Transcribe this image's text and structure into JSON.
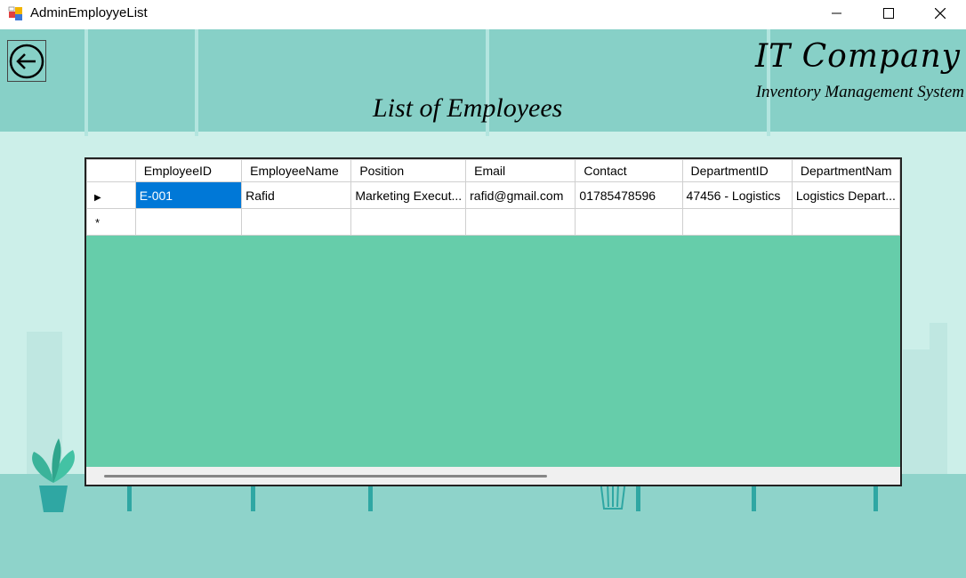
{
  "window": {
    "title": "AdminEmployyeList",
    "icon": "winforms-app-icon",
    "controls": [
      "minimize-icon",
      "maximize-icon",
      "close-icon"
    ]
  },
  "header": {
    "brand": "IT Company",
    "subtitle": "Inventory Management System",
    "page_title": "List of Employees",
    "back_icon": "arrow-left-circle-icon"
  },
  "grid": {
    "columns": [
      "EmployeeID",
      "EmployeeName",
      "Position",
      "Email",
      "Contact",
      "DepartmentID",
      "DepartmentNam"
    ],
    "rows": [
      {
        "indicator": "▶",
        "cells": [
          "E-001",
          "Rafid",
          "Marketing Execut...",
          "rafid@gmail.com",
          "01785478596",
          "47456 - Logistics",
          "Logistics Depart..."
        ]
      }
    ],
    "new_row_indicator": "*",
    "colors": {
      "selection": "#0078d7",
      "background": "#66cdaa"
    }
  }
}
